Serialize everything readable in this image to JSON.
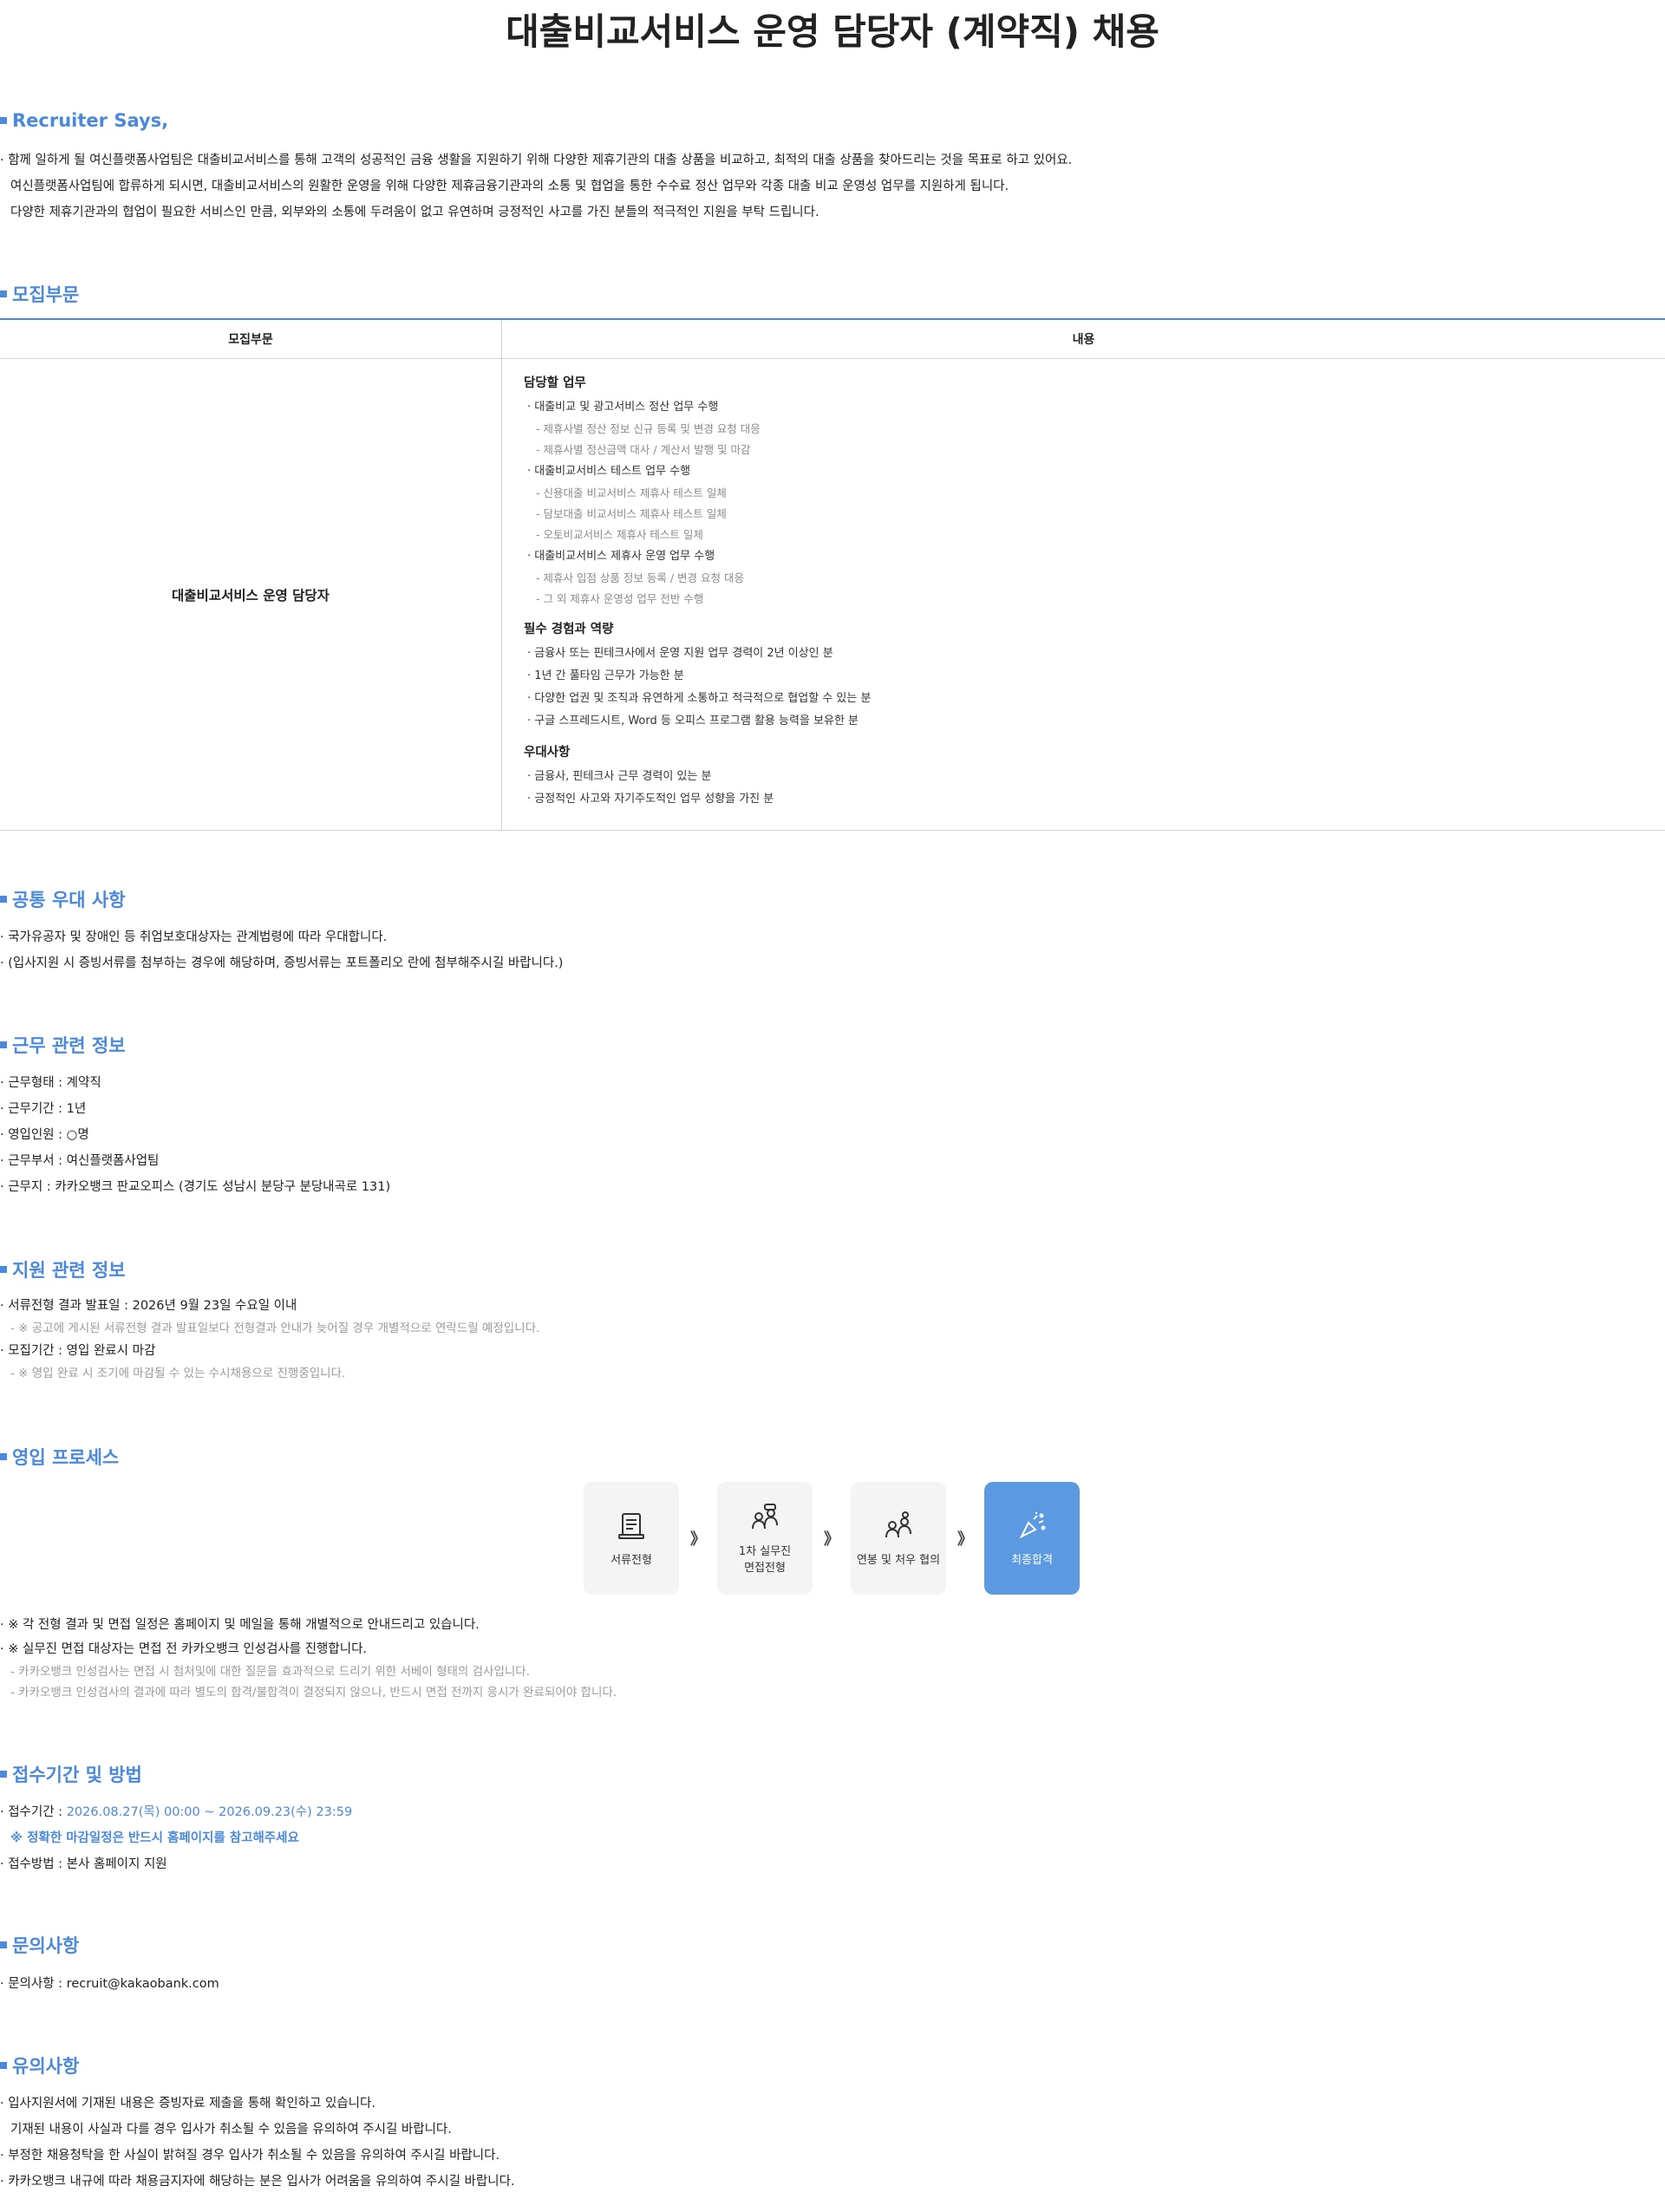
{
  "title": "대출비교서비스 운영 담당자 (계약직) 채용",
  "recruiter": {
    "heading": "Recruiter Says,",
    "lines": [
      "· 함께 일하게 될 여신플랫폼사업팀은 대출비교서비스를 통해 고객의 성공적인 금융 생활을 지원하기 위해 다양한 제휴기관의 대출 상품을 비교하고, 최적의 대출 상품을 찾아드리는 것을 목표로 하고 있어요.",
      "여신플랫폼사업팀에 합류하게 되시면, 대출비교서비스의 원활한 운영을 위해 다양한 제휴금융기관과의 소통 및 협업을 통한 수수료 정산 업무와 각종 대출 비교 운영성 업무를 지원하게 됩니다.",
      "다양한 제휴기관과의 협업이 필요한 서비스인 만큼, 외부와의 소통에 두려움이 없고 유연하며 긍정적인 사고를 가진 분들의 적극적인 지원을 부탁 드립니다."
    ]
  },
  "recruit": {
    "heading": "모집부문",
    "col1": "모집부문",
    "col2": "내용",
    "position": "대출비교서비스 운영 담당자",
    "duties_title": "담당할 업무",
    "duties": [
      {
        "item": "· 대출비교 및 광고서비스 정산 업무 수행",
        "subs": [
          "- 제휴사별 정산 정보 신규 등록 및 변경 요청 대응",
          "- 제휴사별 정산금액 대사 / 계산서 발행 및 마감"
        ]
      },
      {
        "item": "· 대출비교서비스 테스트 업무 수행",
        "subs": [
          "- 신용대출 비교서비스 제휴사 테스트 일체",
          "- 담보대출 비교서비스 제휴사 테스트 일체",
          "- 오토비교서비스 제휴사 테스트 일체"
        ]
      },
      {
        "item": "· 대출비교서비스 제휴사 운영 업무 수행",
        "subs": [
          "- 제휴사 입점 상품 정보 등록 / 변경 요청 대응",
          "- 그 외 제휴사 운영성 업무 전반 수행"
        ]
      }
    ],
    "req_title": "필수 경험과 역량",
    "requirements": [
      "· 금융사 또는 핀테크사에서 운영 지원 업무 경력이 2년 이상인 분",
      "· 1년 간 풀타임 근무가 가능한 분",
      "· 다양한 업권 및 조직과 유연하게 소통하고 적극적으로 협업할 수 있는 분",
      "· 구글 스프레드시트, Word 등 오피스 프로그램 활용 능력을 보유한 분"
    ],
    "pref_title": "우대사항",
    "preferences": [
      "· 금융사, 핀테크사 근무 경력이 있는 분",
      "· 긍정적인 사고와 자기주도적인 업무 성향을 가진 분"
    ]
  },
  "common_pref": {
    "heading": "공통 우대 사항",
    "lines": [
      "· 국가유공자 및 장애인 등 취업보호대상자는 관계법령에 따라 우대합니다.",
      "· (입사지원 시 증빙서류를 첨부하는 경우에 해당하며, 증빙서류는 포트폴리오 란에 첨부해주시길 바랍니다.)"
    ]
  },
  "work_info": {
    "heading": "근무 관련 정보",
    "lines": [
      "· 근무형태 : 계약직",
      "· 근무기간 : 1년",
      "· 영입인원 : ○명",
      "· 근무부서 : 여신플랫폼사업팀",
      "· 근무지 : 카카오뱅크 판교오피스 (경기도 성남시 분당구 분당내곡로 131)"
    ]
  },
  "apply_info": {
    "heading": "지원 관련 정보",
    "line1": "· 서류전형 결과 발표일 : 2026년 9월 23일 수요일 이내",
    "note1": "- ※ 공고에 게시된 서류전형 결과 발표일보다 전형결과 안내가 늦어질 경우 개별적으로 연락드릴 예정입니다.",
    "line2": "· 모집기간 : 영입 완료시 마감",
    "note2": "- ※ 영입 완료 시 조기에 마감될 수 있는 수시채용으로 진행중입니다."
  },
  "process": {
    "heading": "영입 프로세스",
    "steps": [
      {
        "label": "서류전형",
        "icon": "document-icon"
      },
      {
        "label": "1차 실무진\n면접전형",
        "icon": "interview-icon"
      },
      {
        "label": "연봉 및 처우 협의",
        "icon": "negotiation-icon"
      },
      {
        "label": "최종합격",
        "icon": "celebration-icon"
      }
    ],
    "arrow": "》",
    "line1": "· ※ 각 전형 결과 및 면접 일정은 홈페이지 및 메일을 통해 개별적으로 안내드리고 있습니다.",
    "line2": "· ※ 실무진 면접 대상자는 면접 전 카카오뱅크 인성검사를 진행합니다.",
    "note1": "- 카카오뱅크 인성검사는 면접 시 첨처및에 대한 질문을 효과적으로 드리기 위한 서베이 형태의 검사입니다.",
    "note2": "- 카카오뱅크 인성검사의 결과에 따라 별도의 합격/불합격이 결정되지 않으나, 반드시 면접 전까지 응시가 완료되어야 합니다."
  },
  "period": {
    "heading": "접수기간 및 방법",
    "label": "· 접수기간 : ",
    "value": "2026.08.27(목) 00:00 ~ 2026.09.23(수) 23:59",
    "notice": "※ 정확한 마감일정은 반드시 홈페이지를 참고해주세요",
    "method": "· 접수방법 : 본사 홈페이지 지원"
  },
  "contact": {
    "heading": "문의사항",
    "line": "· 문의사항 : recruit@kakaobank.com"
  },
  "caution": {
    "heading": "유의사항",
    "lines": [
      "· 입사지원서에 기재된 내용은 증빙자료 제출을 통해 확인하고 있습니다.",
      "기재된 내용이 사실과 다를 경우 입사가 취소될 수 있음을 유의하여 주시길 바랍니다.",
      "· 부정한 채용청탁을 한 사실이 밝혀질 경우 입사가 취소될 수 있음을 유의하여 주시길 바랍니다.",
      "· 카카오뱅크 내규에 따라 채용금지자에 해당하는 분은 입사가 어려움을 유의하여 주시길 바랍니다."
    ]
  },
  "colors": {
    "accent": "#4a89dc",
    "final_step": "#5b9ae0"
  }
}
